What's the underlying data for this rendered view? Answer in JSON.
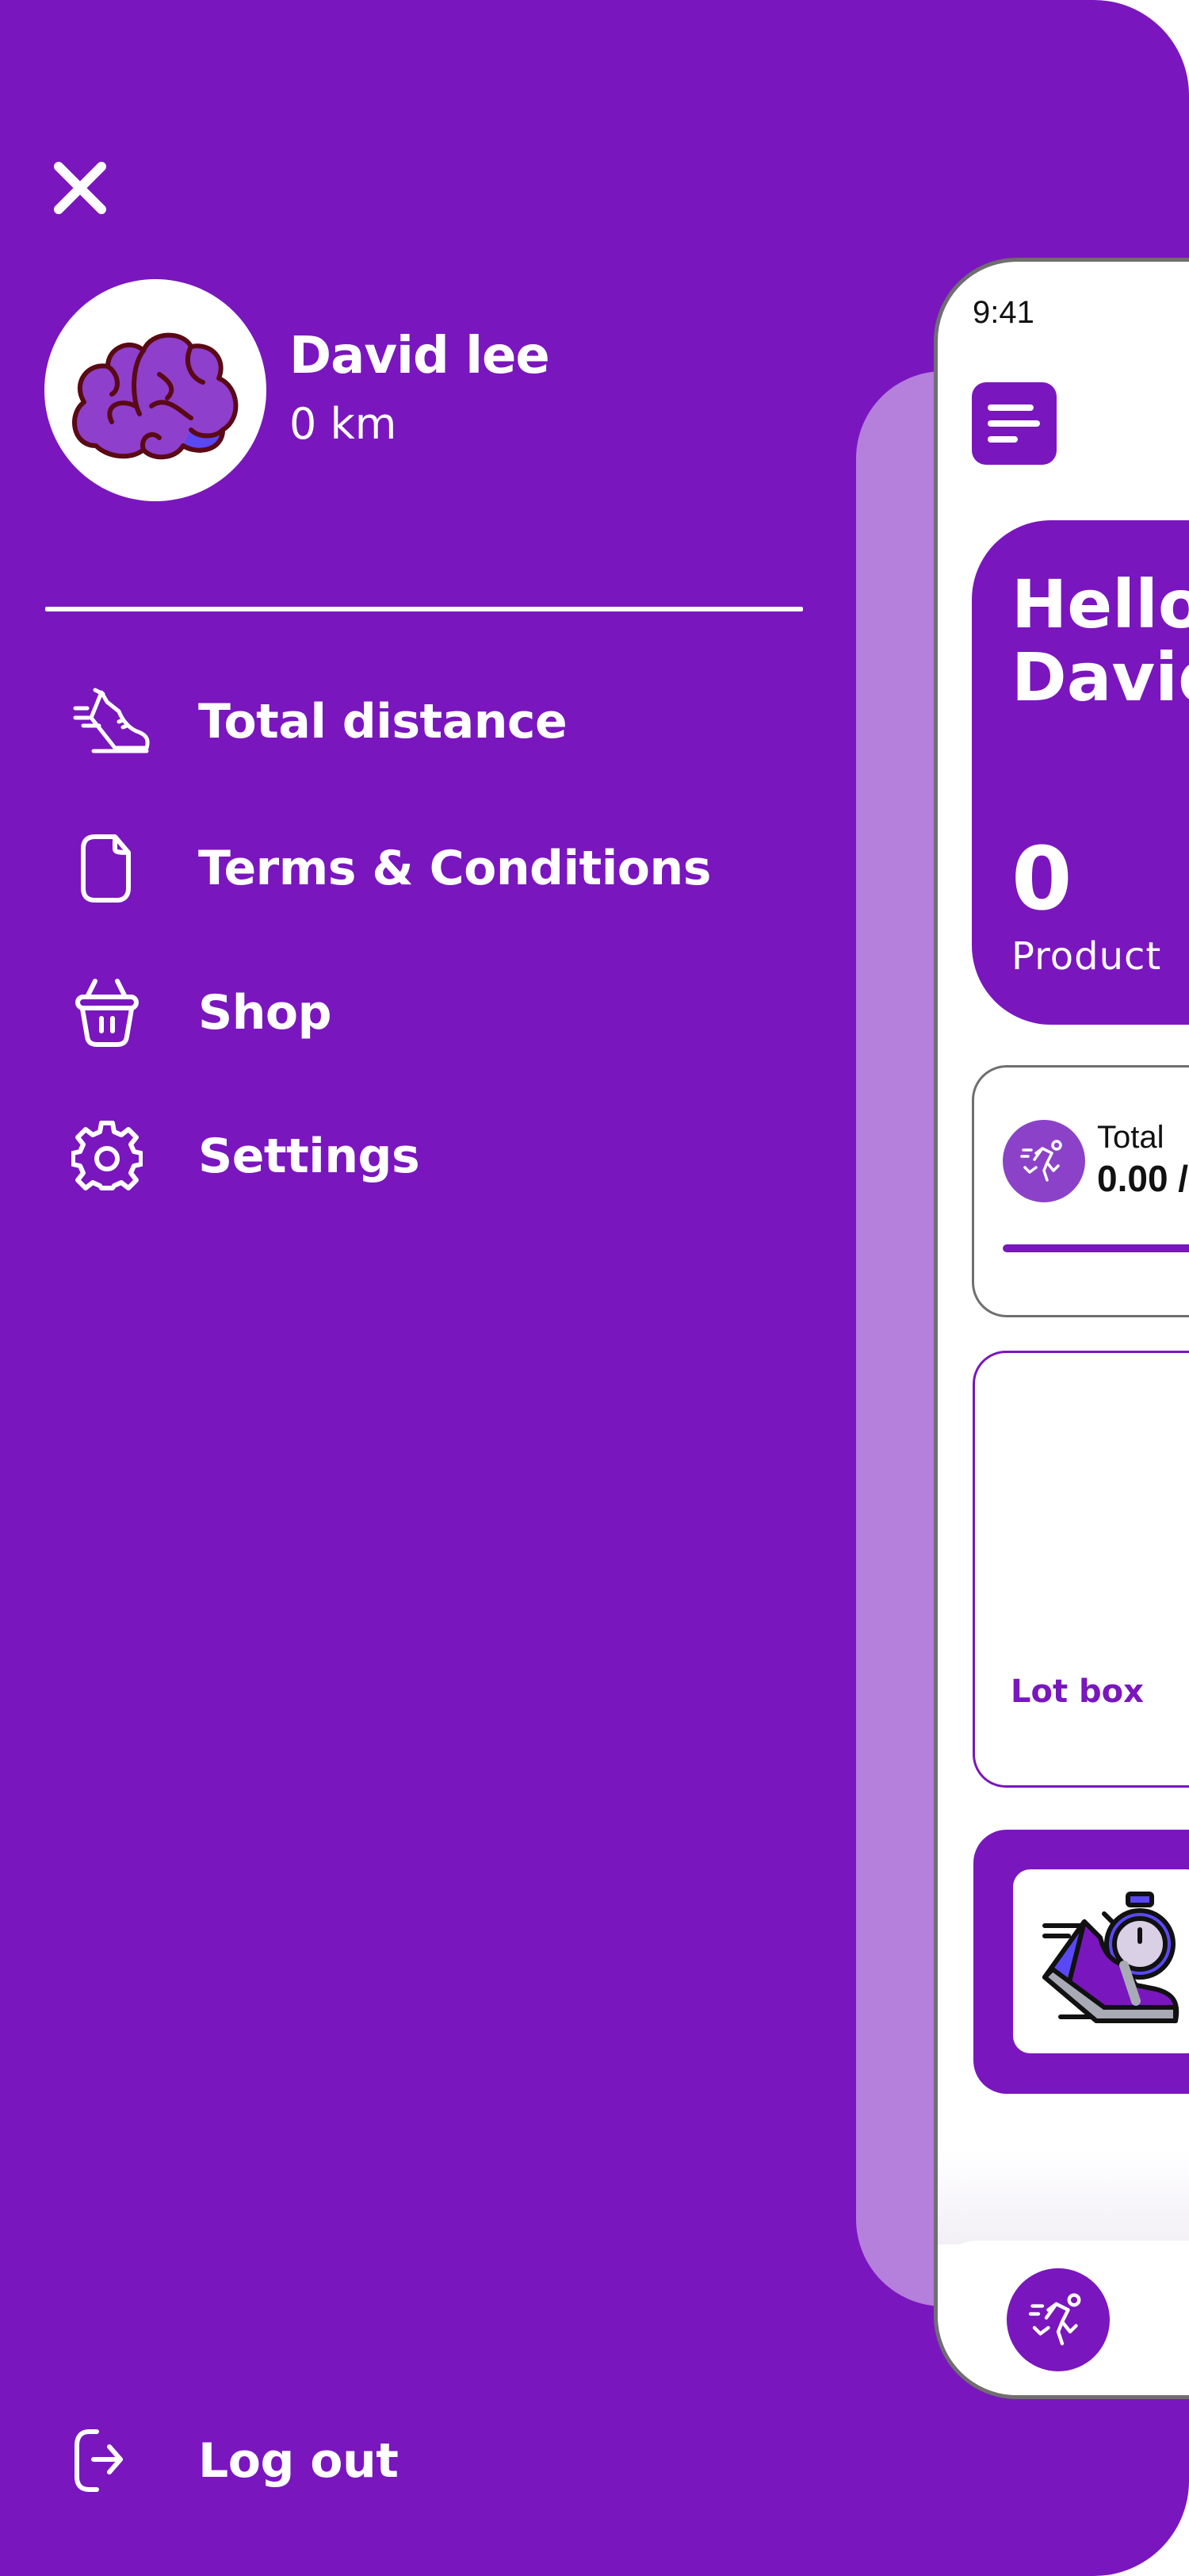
{
  "theme": {
    "primary": "#7a16be",
    "secondary": "#b57fdc",
    "accent_blue": "#5a48f5"
  },
  "drawer": {
    "close_icon": "close-icon",
    "user": {
      "name": "David lee",
      "distance": "0 km",
      "avatar_icon": "brain-icon"
    },
    "menu": [
      {
        "icon": "running-shoe-icon",
        "label": "Total distance"
      },
      {
        "icon": "document-icon",
        "label": "Terms & Conditions"
      },
      {
        "icon": "basket-icon",
        "label": "Shop"
      },
      {
        "icon": "gear-icon",
        "label": "Settings"
      }
    ],
    "logout": {
      "icon": "logout-icon",
      "label": "Log out"
    }
  },
  "phone_preview": {
    "status_time": "9:41",
    "menu_icon": "hamburger-icon",
    "hello_card": {
      "greeting": "Hello\nDavid",
      "product_count": "0",
      "product_label": "Product"
    },
    "total_card": {
      "icon": "runner-icon",
      "label": "Total",
      "value": "0.00 /",
      "progress": 1.0
    },
    "lot_box": {
      "label": "Lot box"
    },
    "promo_card": {
      "image_icon": "shoe-stopwatch-icon"
    },
    "bottom_nav": {
      "active_icon": "runner-icon"
    }
  }
}
